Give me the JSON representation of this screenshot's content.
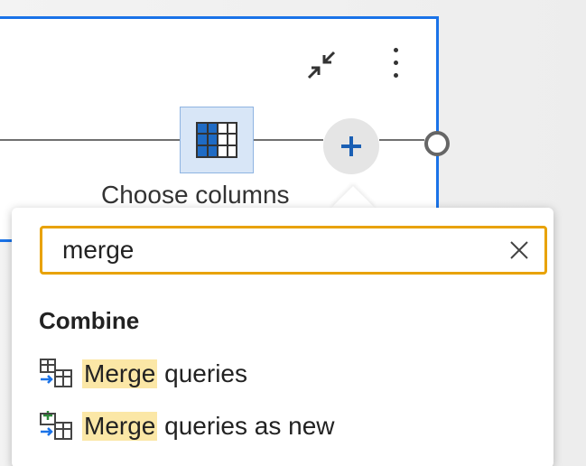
{
  "step": {
    "label": "Choose columns",
    "collapse_icon": "collapse-arrows-icon",
    "more_icon": "more-vertical-icon",
    "table_icon": "table-grid-icon",
    "add_icon": "plus-icon"
  },
  "search": {
    "value": "merge",
    "placeholder": "",
    "clear_icon": "close-icon"
  },
  "results": {
    "group": "Combine",
    "items": [
      {
        "highlight": "Merge",
        "rest": " queries",
        "icon": "merge-queries-icon"
      },
      {
        "highlight": "Merge",
        "rest": " queries as new",
        "icon": "merge-queries-new-icon"
      }
    ]
  },
  "colors": {
    "accent_blue": "#1a73e8",
    "search_border": "#e8a200",
    "highlight": "#fbe7a6"
  }
}
